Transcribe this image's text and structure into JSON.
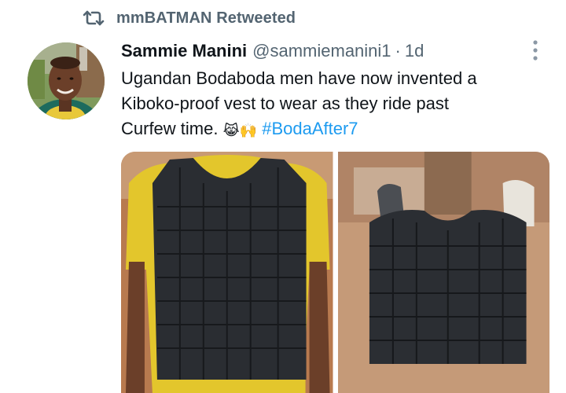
{
  "retweet": {
    "icon": "retweet-icon",
    "label": "mmBATMAN Retweeted"
  },
  "tweet": {
    "author": {
      "display_name": "Sammie Manini",
      "handle": "@sammiemanini1",
      "separator": "·",
      "time": "1d",
      "avatar": "avatar-photo"
    },
    "text_lines": [
      "Ugandan Bodaboda men have now invented a",
      "Kiboko-proof vest to wear as they ride past"
    ],
    "text_line3_prefix": "Curfew time.",
    "emojis": [
      "😹",
      "🙌"
    ],
    "hashtag": "#BodaAfter7",
    "more_icon": "more-options-icon",
    "media": [
      {
        "name": "photo-person-wearing-tire-vest"
      },
      {
        "name": "photo-tire-vest-on-ground"
      }
    ]
  },
  "colors": {
    "text": "#0f1419",
    "secondary": "#536471",
    "link": "#1d9bf0"
  }
}
